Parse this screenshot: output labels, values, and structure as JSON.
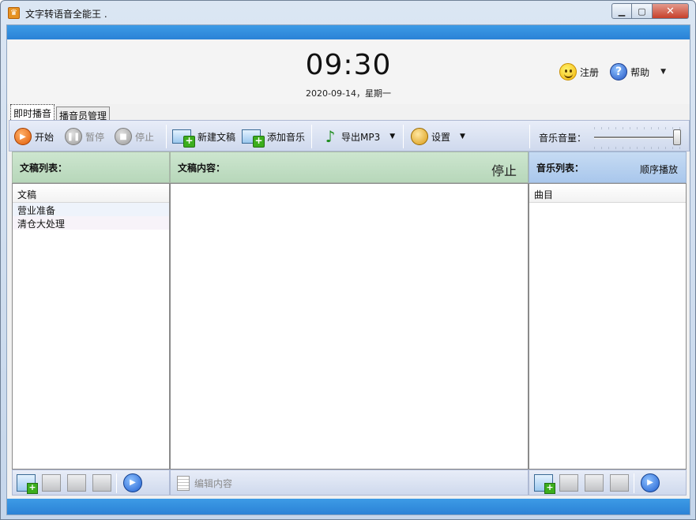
{
  "window": {
    "title": "文字转语音全能王 .",
    "app_icon": "crown-icon"
  },
  "header": {
    "clock": "09:30",
    "date": "2020-09-14，星期一",
    "register_label": "注册",
    "help_label": "帮助"
  },
  "tabs": [
    {
      "label": "即时播音",
      "active": true
    },
    {
      "label": "播音员管理",
      "active": false
    }
  ],
  "toolbar": {
    "start_label": "开始",
    "pause_label": "暂停",
    "stop_label": "停止",
    "new_doc_label": "新建文稿",
    "add_music_label": "添加音乐",
    "export_label": "导出MP3",
    "settings_label": "设置",
    "volume_label": "音乐音量：",
    "volume_level": 1.0
  },
  "doc_list": {
    "title": "文稿列表：",
    "column": "文稿",
    "items": [
      "营业准备",
      "清仓大处理"
    ]
  },
  "doc_content": {
    "title": "文稿内容：",
    "status": "停止",
    "edit_label": "编辑内容"
  },
  "music_list": {
    "title": "音乐列表：",
    "mode": "顺序播放",
    "column": "曲目",
    "items": []
  },
  "colors": {
    "accent_strip": "#2b82d6",
    "green_header": "#b7d7ba",
    "blue_header": "#a9c7ec"
  }
}
